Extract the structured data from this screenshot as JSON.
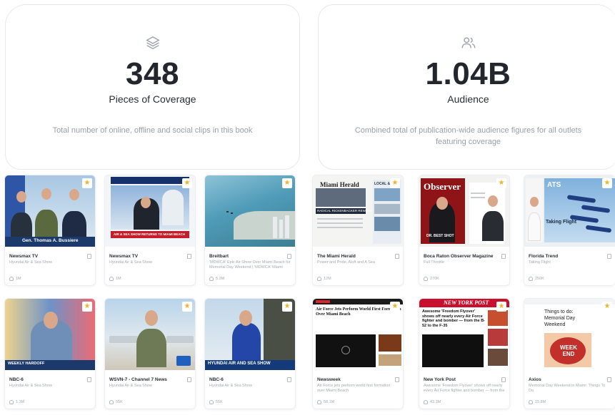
{
  "stats": {
    "coverage": {
      "icon": "layers-icon",
      "value": "348",
      "label": "Pieces of Coverage",
      "description": "Total number of online, offline and social clips in this book"
    },
    "audience": {
      "icon": "users-icon",
      "value": "1.04B",
      "label": "Audience",
      "description": "Combined total of publication-wide audience figures for all outlets featuring coverage"
    }
  },
  "tiles": [
    {
      "outlet": "Newsmax TV",
      "headline": "Hyundai Air & Sea Show",
      "reach": "1M",
      "starred": true
    },
    {
      "outlet": "Newsmax TV",
      "headline": "Hyundai Air & Sea Show",
      "reach": "1M",
      "starred": true
    },
    {
      "outlet": "Breitbart",
      "headline": "'MDWCA' Epic Air Show Over Miami Beach for Memorial Day Weekend | 'MDWCA' Miami Bea...",
      "reach": "5.3M",
      "starred": true
    },
    {
      "outlet": "The Miami Herald",
      "headline": "Power and Pride, Aloft and A Sea",
      "reach": "12M",
      "starred": true
    },
    {
      "outlet": "Boca Raton Observer Magazine",
      "headline": "Full Throttle",
      "reach": "270K",
      "starred": true
    },
    {
      "outlet": "Florida Trend",
      "headline": "Taking Flight",
      "reach": "250K",
      "starred": true
    },
    {
      "outlet": "NBC-6",
      "headline": "Hyundai Air & Sea Show",
      "reach": "1.3M",
      "starred": true
    },
    {
      "outlet": "WSVN-7 - Channel 7 News",
      "headline": "Hyundai Air & Sea Show",
      "reach": "55K",
      "starred": true
    },
    {
      "outlet": "NBC-6",
      "headline": "Hyundai Air & Sea Show",
      "reach": "55K",
      "starred": true
    },
    {
      "outlet": "Newsweek",
      "headline": "Air Force jets perform world first formation over Miami Beach",
      "reach": "58.1M",
      "starred": true
    },
    {
      "outlet": "New York Post",
      "headline": "Awesome 'Freedom Flyover' shows off nearly every Air Force fighter and bomber — from the B-52 to the F-35",
      "reach": "43.3M",
      "starred": true
    },
    {
      "outlet": "Axios",
      "headline": "Memorial Day Weekend in Miami: Things To Do",
      "reach": "15.8M",
      "starred": true
    }
  ],
  "thumbnails": {
    "t1_caption": "Gen. Thomas A. Bussiere",
    "t2_caption": "AIR & SEA SHOW RETURNS TO MIAMI BEACH",
    "t4_masthead": "Miami Herald",
    "t4_caption": "RADICAL RICKENBACKER REWARD",
    "t4_side": "LOCAL & STAT",
    "t5_masthead": "Observer",
    "t5_caption": "DR. BEST SHOT",
    "t6_masthead": "ATS",
    "t6_caption": "Taking Flight",
    "t7_caption": "WEEKLY HARDOFF",
    "t9_caption": "HYUNDAI AIR AND SEA SHOW",
    "t10_title": "Air Force Jets Perform World First Formation Over Miami Beach",
    "t11_masthead": "NEW YORK POST",
    "t11_title": "Awesome 'Freedom Flyover' shows off nearly every Air Force fighter and bomber — from the B-52 to the F-35",
    "t12_title": "Things to do: Memorial Day Weekend",
    "t12_badge": "WEEK END"
  }
}
